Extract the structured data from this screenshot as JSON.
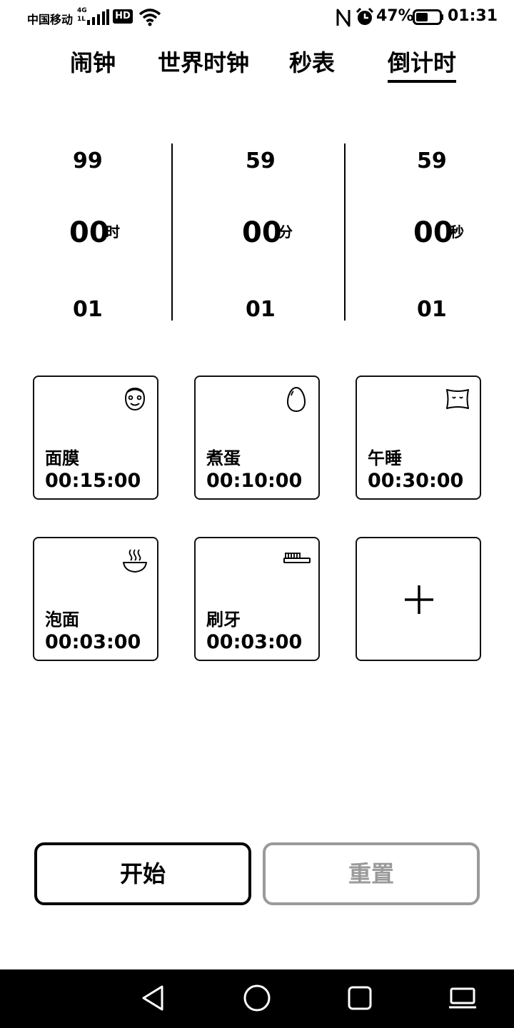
{
  "status_bar": {
    "carrier": "中国移动",
    "network": "4G",
    "network_sub": "1L",
    "hd": "HD",
    "battery": "47%",
    "time": "01:31",
    "icons": [
      "signal-icon",
      "wifi-icon",
      "nfc-icon",
      "alarm-icon",
      "battery-icon"
    ]
  },
  "tabs": [
    {
      "label": "闹钟",
      "active": false
    },
    {
      "label": "世界时钟",
      "active": false
    },
    {
      "label": "秒表",
      "active": false
    },
    {
      "label": "倒计时",
      "active": true
    }
  ],
  "picker": {
    "hours": {
      "prev": "99",
      "current": "00",
      "next": "01",
      "unit": "时"
    },
    "minutes": {
      "prev": "59",
      "current": "00",
      "next": "01",
      "unit": "分"
    },
    "seconds": {
      "prev": "59",
      "current": "00",
      "next": "01",
      "unit": "秒"
    }
  },
  "presets": [
    {
      "name": "面膜",
      "time": "00:15:00",
      "icon": "face-mask-icon"
    },
    {
      "name": "煮蛋",
      "time": "00:10:00",
      "icon": "egg-icon"
    },
    {
      "name": "午睡",
      "time": "00:30:00",
      "icon": "pillow-icon"
    },
    {
      "name": "泡面",
      "time": "00:03:00",
      "icon": "noodle-bowl-icon"
    },
    {
      "name": "刷牙",
      "time": "00:03:00",
      "icon": "toothbrush-icon"
    }
  ],
  "add_preset_icon": "plus-icon",
  "buttons": {
    "start": "开始",
    "reset": "重置"
  },
  "colors": {
    "text": "#000000",
    "disabled": "#9a9a9a",
    "nav_bg": "#000000"
  },
  "nav": [
    "back-icon",
    "home-icon",
    "recents-icon",
    "desktop-icon"
  ]
}
